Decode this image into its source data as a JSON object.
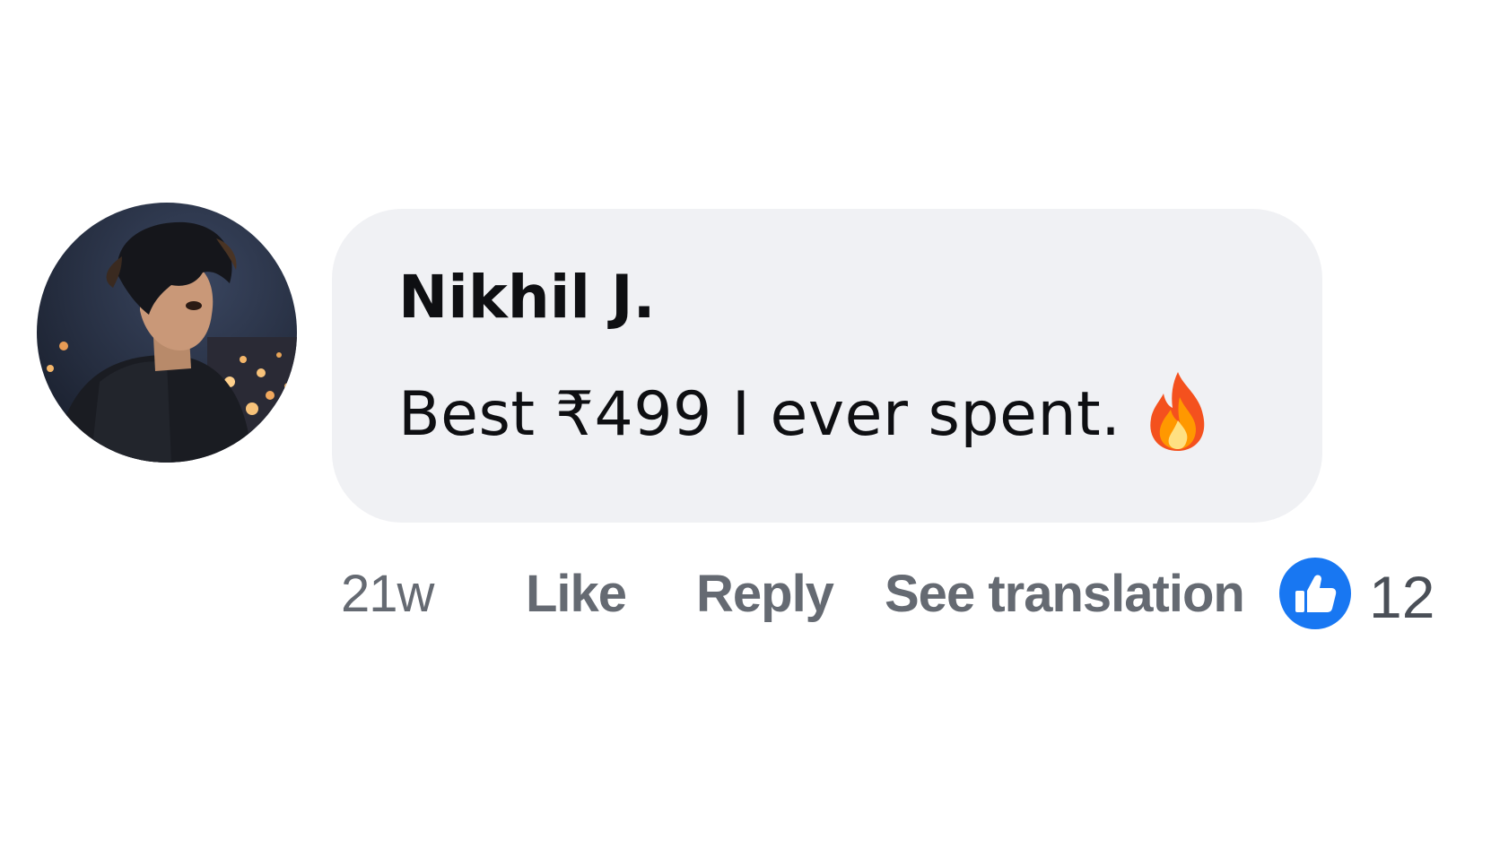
{
  "comment": {
    "author": "Nikhil J.",
    "text": "Best ₹499 I ever spent.",
    "emoji_icon": "fire-icon",
    "avatar_icon": "avatar-anime-boy-hoodie-night-city"
  },
  "actions": {
    "timestamp": "21w",
    "like_label": "Like",
    "reply_label": "Reply",
    "translate_label": "See translation"
  },
  "reactions": {
    "icon": "thumbs-up-icon",
    "count": "12"
  },
  "colors": {
    "bubble_bg": "#f0f1f4",
    "like_blue": "#1877f2",
    "action_gray": "#656a72"
  }
}
